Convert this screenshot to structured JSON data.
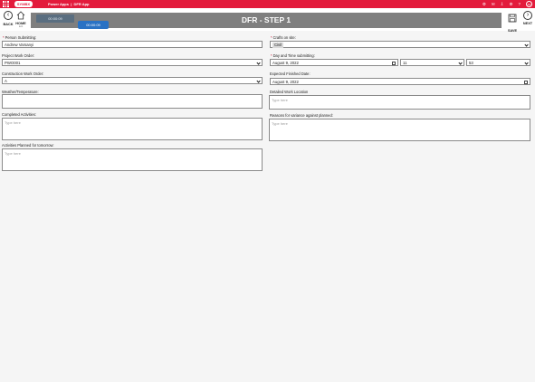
{
  "topbar": {
    "app_title": "Power Apps  |  DFR App",
    "brand_logo": "SYMBX",
    "icons": [
      "gear-icon",
      "mail-icon",
      "download-icon",
      "settings-icon",
      "help-icon"
    ],
    "user_initials": "AV"
  },
  "nav": {
    "back_label": "BACK",
    "home_label": "HOME",
    "home_sublabel": "Edit",
    "page_title": "DFR - STEP 1",
    "timer_primary": "00:00:09",
    "timer_secondary": "00:00:09",
    "save_label": "SAVE",
    "next_label": "NEXT",
    "back_glyph": "‹",
    "next_glyph": "›"
  },
  "form": {
    "person_submitting": {
      "label": "Person Submitting:",
      "value": "Andrew Varsanyi"
    },
    "crafts_on_site": {
      "label": "Crafts on site:",
      "value": "Civil"
    },
    "project_work_order": {
      "label": "Project Work Order:",
      "value": "PWO001"
    },
    "day_time_submitting": {
      "label": "Day and Time submitting:",
      "date": "August 9, 2022",
      "hour": "11",
      "minute": "53"
    },
    "construction_work_order": {
      "label": "Construction Work Order:",
      "value": "A"
    },
    "expected_finished_date": {
      "label": "Expected Finished Date:",
      "value": "August 9, 2022"
    },
    "weather_temperature": {
      "label": "Weather/Temperature:",
      "value": ""
    },
    "detailed_work_location": {
      "label": "Detailed Work Location",
      "placeholder": "Type here"
    },
    "completed_activities": {
      "label": "Completed Activities:",
      "placeholder": "Type here"
    },
    "reasons_variance": {
      "label": "Reasons for variance against planned:",
      "placeholder": "Type here"
    },
    "activities_planned": {
      "label": "Activities Planned for tomorrow:",
      "placeholder": "Type here"
    },
    "required_marker": "*"
  },
  "colors": {
    "brand": "#e31b3c",
    "title_bar": "#7f7f7f",
    "timer_primary": "#5a6e80",
    "timer_secondary": "#2a72c4"
  }
}
